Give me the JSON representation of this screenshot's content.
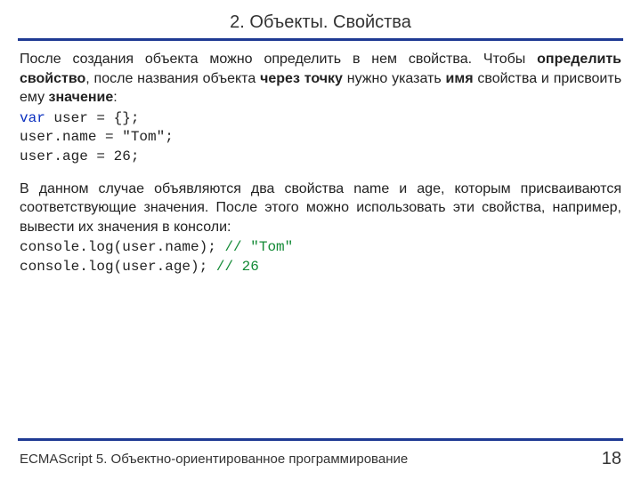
{
  "title": "2. Объекты. Свойства",
  "para1_a": "После создания объекта можно определить в нем свойства. Чтобы ",
  "para1_b": "определить свойство",
  "para1_c": ", после названия объекта ",
  "para1_d": "через точку",
  "para1_e": " нужно указать ",
  "para1_f": "имя",
  "para1_g": " свойства и присвоить ему ",
  "para1_h": "значение",
  "para1_i": ":",
  "code1_kw": "var",
  "code1_rest": " user = {};\nuser.name = \"Tom\";\nuser.age = 26;",
  "para2": "В данном случае объявляются два свойства name и age, которым присваиваются соответствующие значения. После этого можно использовать эти свойства, например, вывести их значения в консоли:",
  "code2_l1": "console.log(user.name); ",
  "code2_c1": "// \"Tom\"",
  "code2_l2": "console.log(user.age); ",
  "code2_c2": "// 26",
  "footer": "ECMAScript 5. Объектно-ориентированное программирование",
  "page": "18"
}
